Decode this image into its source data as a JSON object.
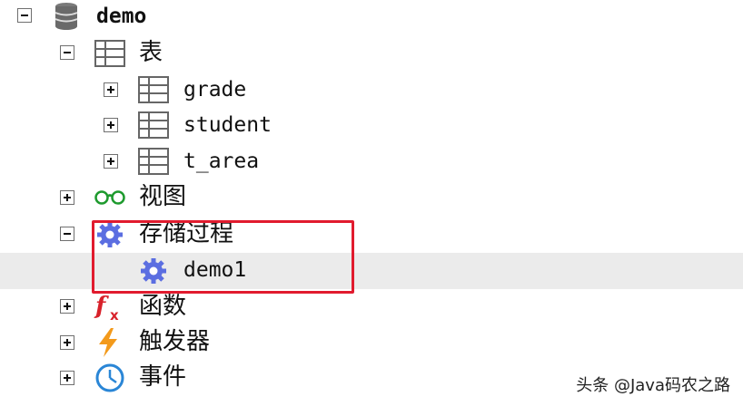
{
  "tree": {
    "database": {
      "label": "demo",
      "icon": "database-icon"
    },
    "tables": {
      "label": "表",
      "icon": "table-icon",
      "children": [
        {
          "label": "grade",
          "icon": "table-icon"
        },
        {
          "label": "student",
          "icon": "table-icon"
        },
        {
          "label": "t_area",
          "icon": "table-icon"
        }
      ]
    },
    "views": {
      "label": "视图",
      "icon": "glasses-icon"
    },
    "procedures": {
      "label": "存储过程",
      "icon": "gear-icon",
      "children": [
        {
          "label": "demo1",
          "icon": "gear-icon"
        }
      ]
    },
    "functions": {
      "label": "函数",
      "icon": "function-icon"
    },
    "triggers": {
      "label": "触发器",
      "icon": "lightning-icon"
    },
    "events": {
      "label": "事件",
      "icon": "clock-icon"
    }
  },
  "colors": {
    "highlight_box": "#e11b2e",
    "gear": "#5b6ee1",
    "selected_row": "#ebebeb"
  },
  "watermark": "头条 @Java码农之路"
}
